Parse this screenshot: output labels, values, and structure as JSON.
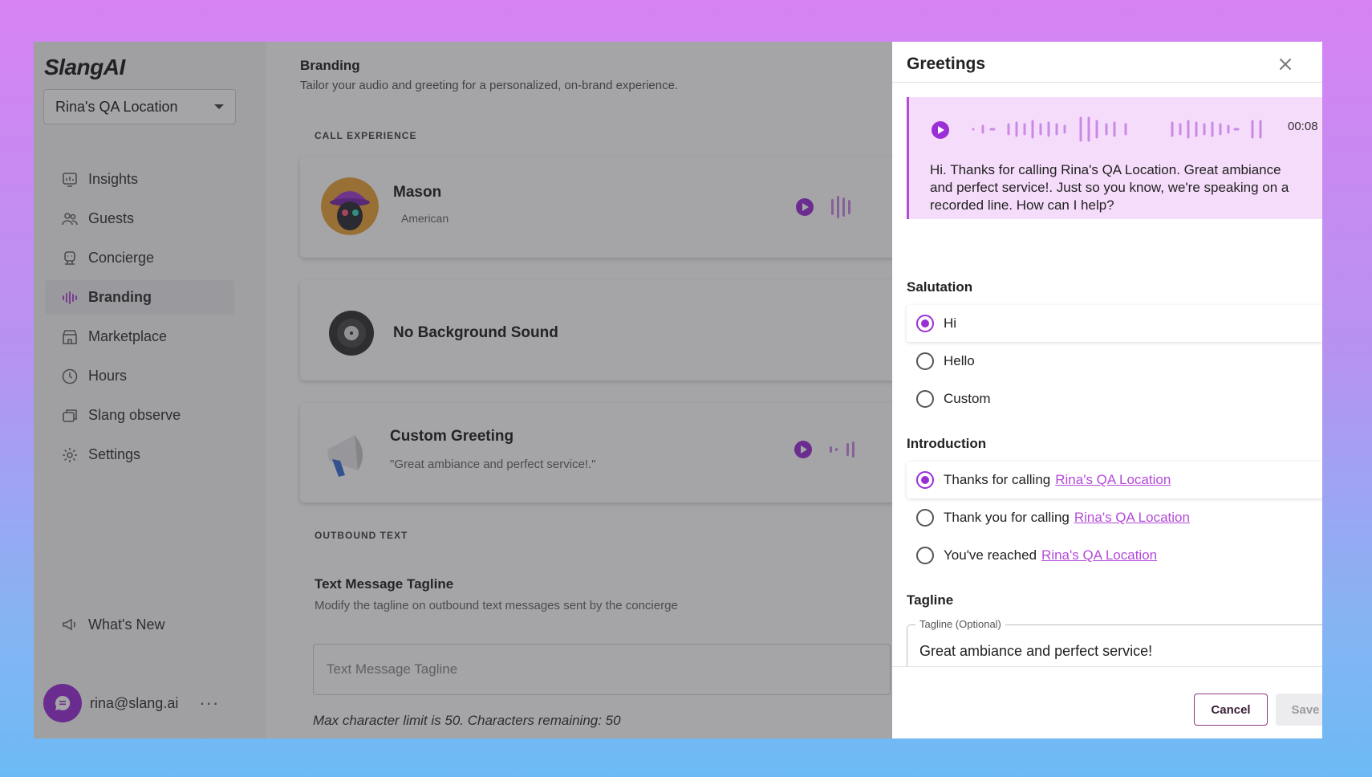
{
  "app": {
    "logo": "SlangAI"
  },
  "sidebar": {
    "location": "Rina's QA Location",
    "items": [
      {
        "label": "Insights",
        "icon": "insights-icon"
      },
      {
        "label": "Guests",
        "icon": "guests-icon"
      },
      {
        "label": "Concierge",
        "icon": "concierge-icon"
      },
      {
        "label": "Branding",
        "icon": "branding-icon"
      },
      {
        "label": "Marketplace",
        "icon": "marketplace-icon"
      },
      {
        "label": "Hours",
        "icon": "clock-icon"
      },
      {
        "label": "Slang observe",
        "icon": "observe-icon"
      },
      {
        "label": "Settings",
        "icon": "gear-icon"
      }
    ],
    "whats_new": "What's New",
    "user_email": "rina@slang.ai",
    "more": "···"
  },
  "main": {
    "title": "Branding",
    "subtitle": "Tailor your audio and greeting for a personalized, on-brand experience.",
    "call_experience_label": "CALL EXPERIENCE",
    "voice": {
      "name": "Mason",
      "accent": "American"
    },
    "background": {
      "label": "No Background Sound"
    },
    "greeting": {
      "title": "Custom Greeting",
      "quote": "\"Great ambiance and perfect service!.\""
    },
    "outbound_label": "OUTBOUND TEXT",
    "tagline_card": {
      "title": "Text Message Tagline",
      "subtitle": "Modify the tagline on outbound text messages sent by the concierge",
      "placeholder": "Text Message Tagline",
      "limit_note": "Max character limit is 50. Characters remaining: 50"
    }
  },
  "panel": {
    "title": "Greetings",
    "preview": {
      "time": "00:08",
      "text": "Hi. Thanks for calling Rina's QA Location. Great ambiance and perfect service!. Just so you know, we're speaking on a recorded line. How can I help?"
    },
    "salutation": {
      "label": "Salutation",
      "options": [
        "Hi",
        "Hello",
        "Custom"
      ],
      "selected": "Hi"
    },
    "introduction": {
      "label": "Introduction",
      "options": [
        "Thanks for calling",
        "Thank you for calling",
        "You've reached"
      ],
      "location_link": "Rina's QA Location",
      "selected": "Thanks for calling"
    },
    "tagline": {
      "label": "Tagline",
      "field_label": "Tagline (Optional)",
      "value": "Great ambiance and perfect service!"
    },
    "cancel_label": "Cancel",
    "save_label": "Save"
  },
  "colors": {
    "accent": "#9b2fd6",
    "link": "#b44ad9",
    "preview_bg": "#f6dcfb"
  }
}
